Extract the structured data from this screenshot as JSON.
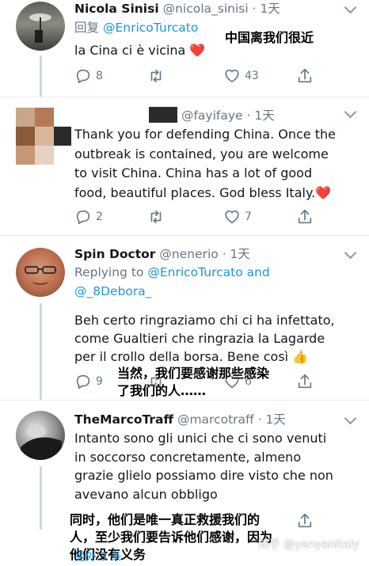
{
  "tweets": [
    {
      "name": "Nicola Sinisi",
      "handle": "@nicola_sinisi",
      "time": "· 1天",
      "reply_prefix": "回复",
      "reply_to": "@EnricoTurcato",
      "body": "la Cina ci è vicina ❤️",
      "counts": {
        "reply": "8",
        "retweet": "",
        "like": "43"
      }
    },
    {
      "name": "",
      "handle": "@fayifaye",
      "time": "· 1天",
      "body": "Thank you for defending China. Once the\noutbreak is contained, you are welcome\nto visit China. China has a lot of good\nfood, beautiful places. God bless Italy.❤️",
      "counts": {
        "reply": "2",
        "retweet": "",
        "like": "7"
      }
    },
    {
      "name": "Spin Doctor",
      "handle": "@nenerio",
      "time": "· 1天",
      "reply_prefix": "Replying to",
      "reply_to": "@EnricoTurcato and",
      "reply_to_2": "@_8Debora_",
      "body": "Beh certo ringraziamo chi ci ha infettato,\ncome Gualtieri che ringrazia la Lagarde\nper il crollo della borsa. Bene così 👍",
      "counts": {
        "reply": "9",
        "retweet": "",
        "like": "6"
      }
    },
    {
      "name": "TheMarcoTraff",
      "handle": "@marcotraff",
      "time": "· 1天",
      "body": "Intanto sono gli unici che ci sono venuti\nin soccorso concretamente, almeno\ngrazie glielo possiamo dire visto che non\navevano alcun obbligo",
      "counts": {
        "reply": "",
        "retweet": "",
        "like": ""
      }
    }
  ],
  "captions": {
    "c1": "中国离我们很近",
    "c2": "当然，我们要感谢那些感染\n了我们的人……",
    "c3": "同时，他们是唯一真正救援我们的\n人，至少我们要告诉他们感谢，因为\n他们没有义务",
    "c3_tail": "另外 3 条"
  },
  "watermark": "知乎 @yanyanItaly",
  "colors": {
    "link": "#1b95e0",
    "muted": "#657786",
    "heart": "#e0245e",
    "divider": "#e6ecf0"
  }
}
